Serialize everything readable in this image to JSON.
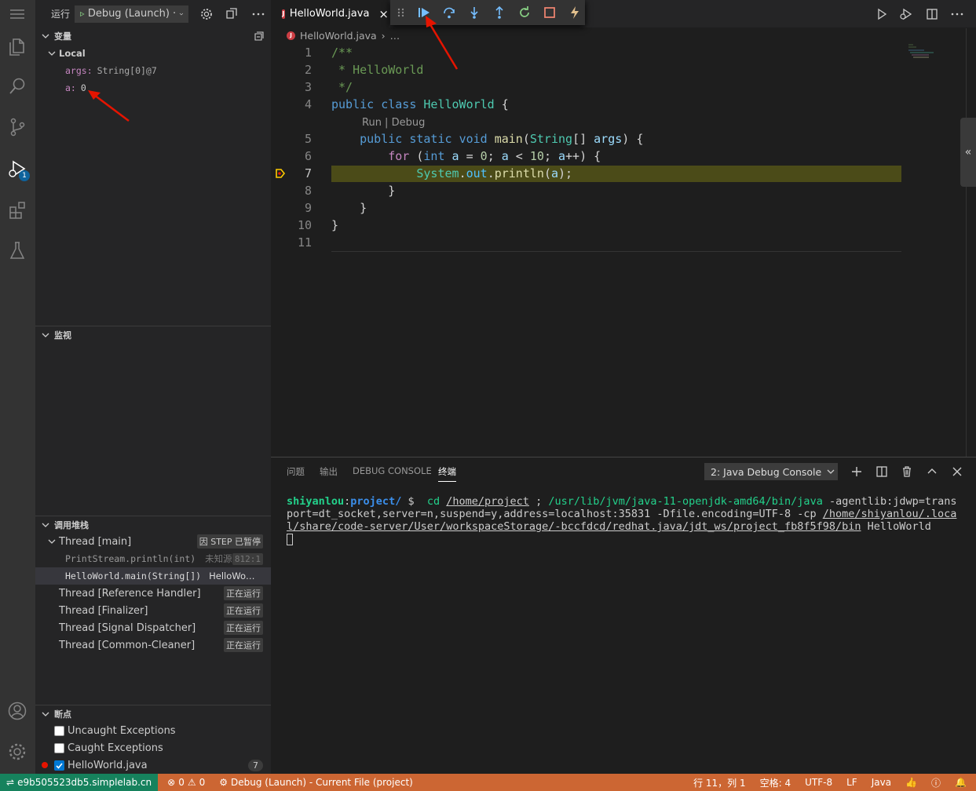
{
  "run_label": "运行",
  "debug_config": "Debug (Launch) ·",
  "sections": {
    "variables": "变量",
    "watch": "监视",
    "callstack": "调用堆栈",
    "breakpoints": "断点"
  },
  "variables": {
    "scope": "Local",
    "items": [
      {
        "name": "args:",
        "value": "String[0]@7"
      },
      {
        "name": "a:",
        "value": "0"
      }
    ]
  },
  "callstack": {
    "main_thread": "Thread [main]",
    "main_status": "因 STEP 已暂停",
    "frames": [
      {
        "name": "PrintStream.println(int)",
        "source": "未知源",
        "line": "812:1"
      },
      {
        "name": "HelloWorld.main(String[])",
        "source": "HelloWo…"
      }
    ],
    "threads": [
      {
        "name": "Thread [Reference Handler]",
        "status": "正在运行"
      },
      {
        "name": "Thread [Finalizer]",
        "status": "正在运行"
      },
      {
        "name": "Thread [Signal Dispatcher]",
        "status": "正在运行"
      },
      {
        "name": "Thread [Common-Cleaner]",
        "status": "正在运行"
      }
    ]
  },
  "breakpoints": {
    "items": [
      {
        "label": "Uncaught Exceptions",
        "checked": false
      },
      {
        "label": "Caught Exceptions",
        "checked": false
      },
      {
        "label": "HelloWorld.java",
        "checked": true,
        "count": "7"
      }
    ]
  },
  "editor": {
    "tab": "HelloWorld.java",
    "close": "×",
    "breadcrumb": "HelloWorld.java",
    "breadcrumb_more": "…",
    "codelens": "Run | Debug"
  },
  "code_lines": [
    "1",
    "2",
    "3",
    "4",
    "5",
    "6",
    "7",
    "8",
    "9",
    "10",
    "11"
  ],
  "panel": {
    "tabs": [
      "问题",
      "输出",
      "DEBUG CONSOLE",
      "终端"
    ],
    "terminal_select": "2: Java Debug Console"
  },
  "terminal": {
    "prompt_user": "shiyanlou",
    "prompt_sep": ":",
    "prompt_path": "project/",
    "prompt_end": " $ ",
    "cmd_cd": "cd",
    "cmd_dir": "/home/project",
    "cmd_semicolon": " ; ",
    "cmd_java": "/usr/lib/jvm/java-11-openjdk-amd64/bin/java",
    "cmd_args": " -agentlib:jdwp=transport=dt_socket,server=n,suspend=y,address=localhost:35831 -Dfile.encoding=UTF-8 -cp ",
    "cmd_cp": "/home/shiyanlou/.local/share/code-server/User/workspaceStorage/-bccfdcd/redhat.java/jdt_ws/project_fb8f5f98/bin",
    "cmd_main": " HelloWorld"
  },
  "status": {
    "remote": "e9b505523db5.simplelab.cn",
    "errors": "0",
    "warnings": "0",
    "debug": "Debug (Launch) - Current File (project)",
    "position": "行 11，列 1",
    "spaces": "空格: 4",
    "encoding": "UTF-8",
    "eol": "LF",
    "language": "Java"
  },
  "activity_badge": "1",
  "colors": {
    "status_bg": "#cc6633",
    "highlight": "#4b4b18",
    "breakpoint": "#e51400"
  }
}
